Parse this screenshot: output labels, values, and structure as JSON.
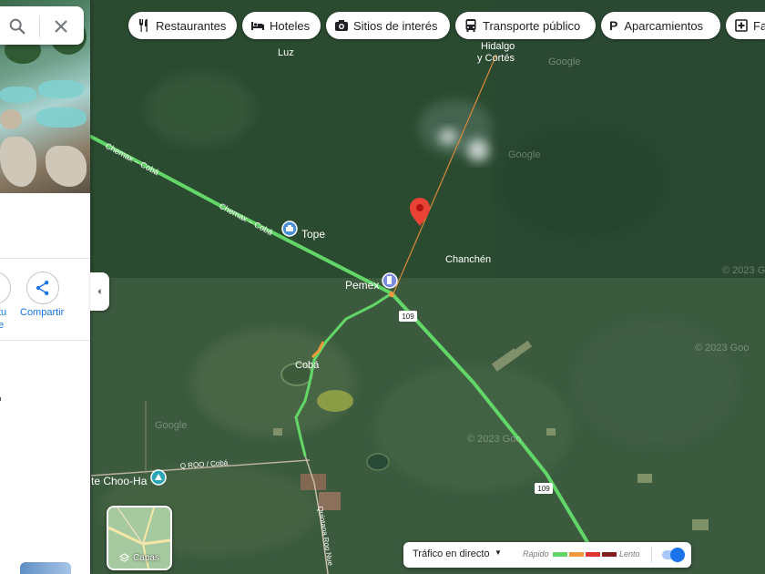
{
  "search": {
    "search_icon": "search-icon",
    "close_icon": "close-icon"
  },
  "panel": {
    "share_label": "Compartir",
    "cut_label_line1": "tu",
    "cut_label_line2": "e",
    "collapse_icon": "chevron-left-icon"
  },
  "chips": [
    {
      "label": "Restaurantes",
      "icon": "fork-knife-icon"
    },
    {
      "label": "Hoteles",
      "icon": "bed-icon"
    },
    {
      "label": "Sitios de interés",
      "icon": "camera-icon"
    },
    {
      "label": "Transporte público",
      "icon": "bus-icon"
    },
    {
      "label": "Aparcamientos",
      "icon": "parking-icon"
    },
    {
      "label": "Fa",
      "icon": "pharmacy-icon"
    }
  ],
  "map": {
    "places": {
      "luz": "Luz",
      "hidalgo_line1": "Hidalgo",
      "hidalgo_line2": "y Cortés",
      "tope": "Tope",
      "chanchen": "Chanchén",
      "pemex": "Pemex",
      "coba": "Cobá",
      "choo_ha": "te Choo-Ha"
    },
    "roads": {
      "chemax_coba_1": "Chemax – Cobá",
      "chemax_coba_2": "Chemax – Cobá",
      "qroo_coba": "Q ROO / Cobá",
      "quintana_roo": "Quintana Roo Nue",
      "shield_109_a": "109",
      "shield_109_b": "109"
    },
    "watermarks": [
      "Google",
      "Google",
      "Google",
      "© 2023 Goo",
      "© 2023 Goo",
      "© 2023 Goo"
    ]
  },
  "layers": {
    "label": "Capas",
    "icon": "layers-icon"
  },
  "traffic": {
    "title": "Tráfico en directo",
    "fast_label": "Rápido",
    "slow_label": "Lento",
    "toggle_on": true,
    "colors": [
      "#63d668",
      "#f29a3b",
      "#e0342f",
      "#811f1f"
    ]
  },
  "colors": {
    "road_fast": "#63d668",
    "road_medium": "#f29a3b",
    "pin": "#ea4335",
    "accent": "#1a73e8"
  }
}
